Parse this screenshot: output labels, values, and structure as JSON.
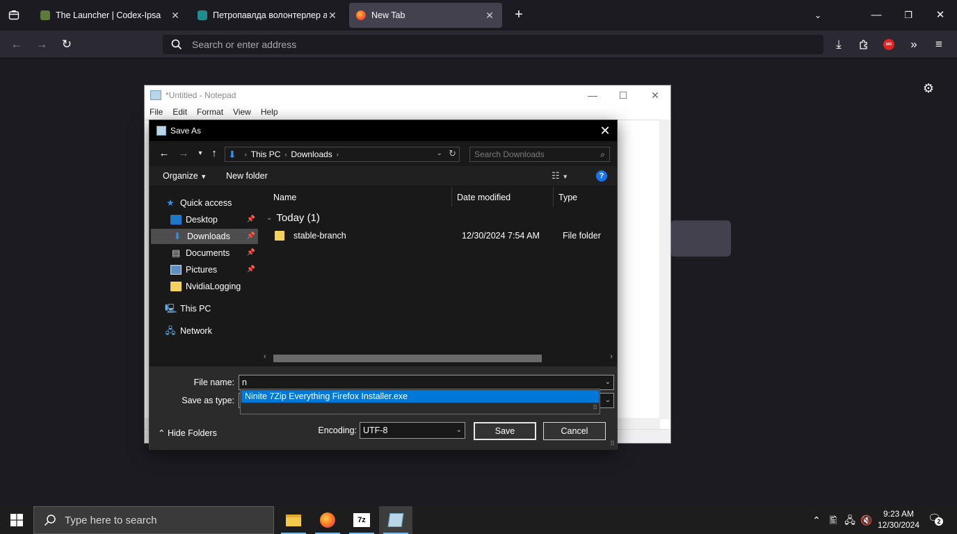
{
  "browser": {
    "tabs": [
      {
        "title": "The Launcher | Codex-Ipsa",
        "active": false
      },
      {
        "title": "Петропавлда волонтерлер ан",
        "active": false
      },
      {
        "title": "New Tab",
        "active": true
      }
    ],
    "address_placeholder": "Search or enter address"
  },
  "notepad": {
    "title": "*Untitled - Notepad",
    "menu": [
      "File",
      "Edit",
      "Format",
      "View",
      "Help"
    ]
  },
  "save_dialog": {
    "title": "Save As",
    "breadcrumb": [
      "This PC",
      "Downloads"
    ],
    "search_placeholder": "Search Downloads",
    "toolbar": {
      "organize": "Organize",
      "new_folder": "New folder",
      "help": "?"
    },
    "tree": [
      {
        "label": "Quick access",
        "icon": "star-icon",
        "pinned": false,
        "selected": false
      },
      {
        "label": "Desktop",
        "icon": "desktop-icon",
        "pinned": true,
        "selected": false
      },
      {
        "label": "Downloads",
        "icon": "download-icon",
        "pinned": true,
        "selected": true
      },
      {
        "label": "Documents",
        "icon": "document-icon",
        "pinned": true,
        "selected": false
      },
      {
        "label": "Pictures",
        "icon": "pictures-icon",
        "pinned": true,
        "selected": false
      },
      {
        "label": "NvidiaLogging",
        "icon": "folder-icon",
        "pinned": false,
        "selected": false
      },
      {
        "label": "This PC",
        "icon": "computer-icon",
        "pinned": false,
        "selected": false
      },
      {
        "label": "Network",
        "icon": "network-icon",
        "pinned": false,
        "selected": false
      }
    ],
    "columns": {
      "name": "Name",
      "date": "Date modified",
      "type": "Type"
    },
    "group": "Today (1)",
    "files": [
      {
        "name": "stable-branch",
        "date": "12/30/2024 7:54 AM",
        "type": "File folder"
      }
    ],
    "file_name_label": "File name:",
    "file_name_value": "n",
    "save_as_type_label": "Save as type:",
    "autocomplete": "Ninite 7Zip Everything Firefox Installer.exe",
    "hide_folders": "Hide Folders",
    "encoding_label": "Encoding:",
    "encoding_value": "UTF-8",
    "save_button": "Save",
    "cancel_button": "Cancel"
  },
  "taskbar": {
    "search_placeholder": "Type here to search",
    "time": "9:23 AM",
    "date": "12/30/2024",
    "notifications": "2"
  }
}
